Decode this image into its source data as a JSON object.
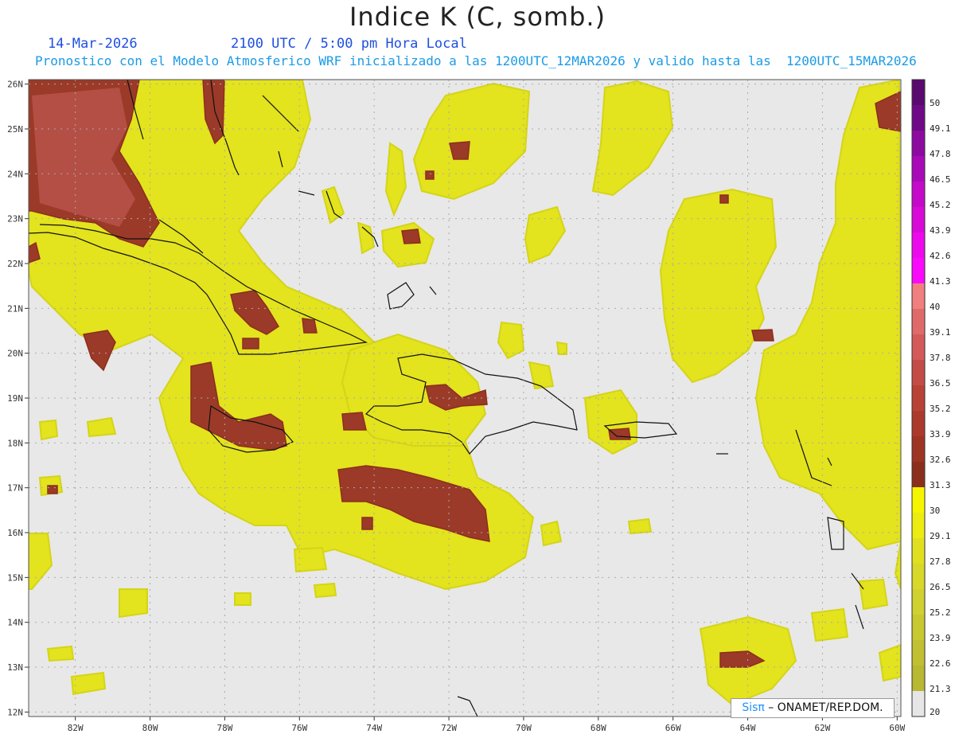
{
  "header": {
    "title": "Indice K (C, somb.)",
    "date": "14-Mar-2026",
    "time": "2100 UTC / 5:00 pm Hora Local",
    "description": "Pronostico con el Modelo Atmosferico WRF inicializado a las 1200UTC_12MAR2026 y valido hasta las  1200UTC_15MAR2026"
  },
  "map": {
    "lon_range": [
      -83.25,
      -59.9
    ],
    "lat_range": [
      11.9,
      26.1
    ],
    "lat_ticks": [
      "26N",
      "25N",
      "24N",
      "23N",
      "22N",
      "21N",
      "20N",
      "19N",
      "18N",
      "17N",
      "16N",
      "15N",
      "14N",
      "13N",
      "12N"
    ],
    "lon_ticks": [
      "82W",
      "80W",
      "78W",
      "76W",
      "74W",
      "72W",
      "70W",
      "68W",
      "66W",
      "64W",
      "62W",
      "60W"
    ],
    "background_color": "#e8e8e8",
    "grid": "dotted"
  },
  "colorbar": {
    "labels": [
      "50",
      "49.1",
      "47.8",
      "46.5",
      "45.2",
      "43.9",
      "42.6",
      "41.3",
      "40",
      "39.1",
      "37.8",
      "36.5",
      "35.2",
      "33.9",
      "32.6",
      "31.3",
      "30",
      "29.1",
      "27.8",
      "26.5",
      "25.2",
      "23.9",
      "22.6",
      "21.3",
      "20"
    ],
    "colors": [
      "#5a0a6e",
      "#6e0a86",
      "#8c0aa0",
      "#a80ab8",
      "#c40ac8",
      "#d80ad8",
      "#ec0aec",
      "#fa0afa",
      "#f07f7f",
      "#e06a6a",
      "#d45a5a",
      "#c44c46",
      "#b84236",
      "#ab3a2c",
      "#9e3424",
      "#8b2f1c",
      "#f5f500",
      "#ecec10",
      "#e0e020",
      "#d8d82a",
      "#d0d030",
      "#c8c830",
      "#c0c032",
      "#b8b832",
      "#e6e6e6"
    ]
  },
  "credit": {
    "sis": "Sisπ",
    "rest": " – ONAMET/REP.DOM."
  }
}
